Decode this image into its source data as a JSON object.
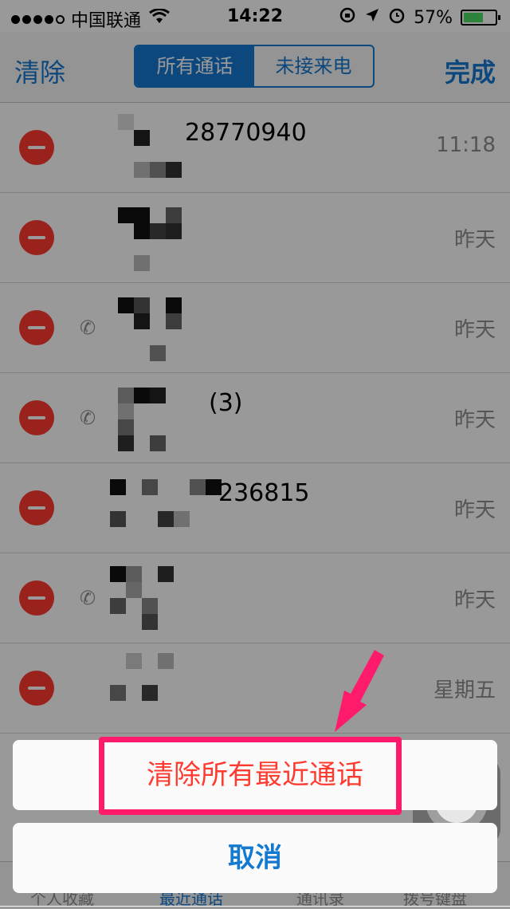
{
  "status_bar": {
    "carrier": "中国联通",
    "time": "14:22",
    "battery": "57%",
    "battery_level": 0.57
  },
  "nav": {
    "left_label": "清除",
    "right_label": "完成",
    "segments": [
      "所有通话",
      "未接来电"
    ],
    "active_segment": 0
  },
  "calls": [
    {
      "name": "28770940",
      "time": "11:18",
      "has_phone_icon": false
    },
    {
      "name": "",
      "time": "昨天",
      "has_phone_icon": false
    },
    {
      "name": "",
      "time": "昨天",
      "has_phone_icon": true
    },
    {
      "name": "(3)",
      "time": "昨天",
      "has_phone_icon": true
    },
    {
      "name": "236815",
      "time": "昨天",
      "has_phone_icon": false
    },
    {
      "name": "",
      "time": "昨天",
      "has_phone_icon": true
    },
    {
      "name": "",
      "time": "星期五",
      "has_phone_icon": false
    }
  ],
  "tab_bar": {
    "items": [
      "个人收藏",
      "最近通话",
      "通讯录",
      "拨号键盘"
    ],
    "active_index": 1
  },
  "action_sheet": {
    "clear_all_label": "清除所有最近通话",
    "cancel_label": "取消"
  },
  "colors": {
    "accent": "#1479d1",
    "destructive": "#ff3b30",
    "highlight": "#ff1a6c"
  }
}
